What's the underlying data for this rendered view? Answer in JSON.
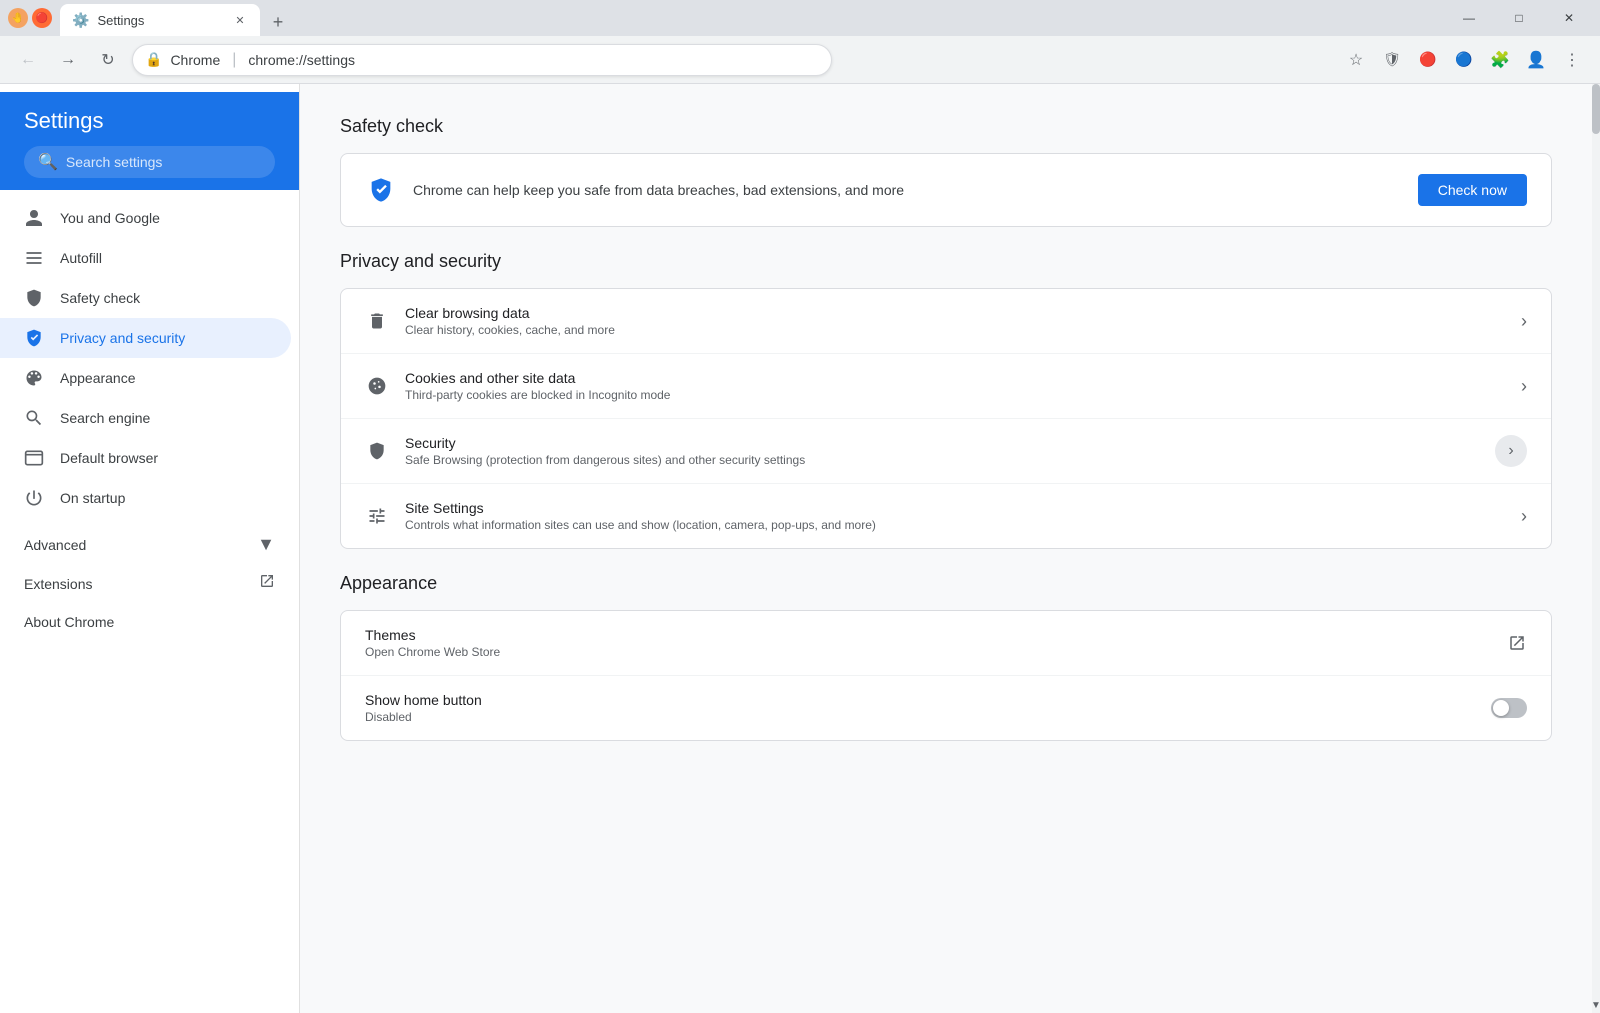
{
  "browser": {
    "tab_title": "Settings",
    "tab_favicon": "⚙",
    "url_scheme": "Chrome",
    "url_separator": "|",
    "url_full": "chrome://settings",
    "new_tab_icon": "+",
    "minimize": "—",
    "maximize": "□",
    "close": "✕"
  },
  "header": {
    "settings_title": "Settings",
    "search_placeholder": "Search settings"
  },
  "sidebar": {
    "items": [
      {
        "id": "you-and-google",
        "label": "You and Google",
        "icon": "person"
      },
      {
        "id": "autofill",
        "label": "Autofill",
        "icon": "autofill"
      },
      {
        "id": "safety-check",
        "label": "Safety check",
        "icon": "shield"
      },
      {
        "id": "privacy-security",
        "label": "Privacy and security",
        "icon": "shield-lock",
        "active": true
      },
      {
        "id": "appearance",
        "label": "Appearance",
        "icon": "palette"
      },
      {
        "id": "search-engine",
        "label": "Search engine",
        "icon": "search"
      },
      {
        "id": "default-browser",
        "label": "Default browser",
        "icon": "browser"
      },
      {
        "id": "on-startup",
        "label": "On startup",
        "icon": "power"
      }
    ],
    "advanced_label": "Advanced",
    "extensions_label": "Extensions",
    "about_chrome_label": "About Chrome"
  },
  "content": {
    "safety_check": {
      "section_title": "Safety check",
      "description": "Chrome can help keep you safe from data breaches, bad extensions, and more",
      "button_label": "Check now"
    },
    "privacy_security": {
      "section_title": "Privacy and security",
      "items": [
        {
          "id": "clear-browsing-data",
          "title": "Clear browsing data",
          "subtitle": "Clear history, cookies, cache, and more",
          "icon": "trash",
          "arrow": true
        },
        {
          "id": "cookies",
          "title": "Cookies and other site data",
          "subtitle": "Third-party cookies are blocked in Incognito mode",
          "icon": "cookie",
          "arrow": true
        },
        {
          "id": "security",
          "title": "Security",
          "subtitle": "Safe Browsing (protection from dangerous sites) and other security settings",
          "icon": "shield",
          "arrow": true,
          "arrow_circle": true
        },
        {
          "id": "site-settings",
          "title": "Site Settings",
          "subtitle": "Controls what information sites can use and show (location, camera, pop-ups, and more)",
          "icon": "sliders",
          "arrow": true
        }
      ]
    },
    "appearance": {
      "section_title": "Appearance",
      "items": [
        {
          "id": "themes",
          "title": "Themes",
          "subtitle": "Open Chrome Web Store",
          "external": true
        },
        {
          "id": "show-home-button",
          "title": "Show home button",
          "subtitle": "Disabled",
          "toggle": true,
          "toggle_on": false
        }
      ]
    }
  }
}
